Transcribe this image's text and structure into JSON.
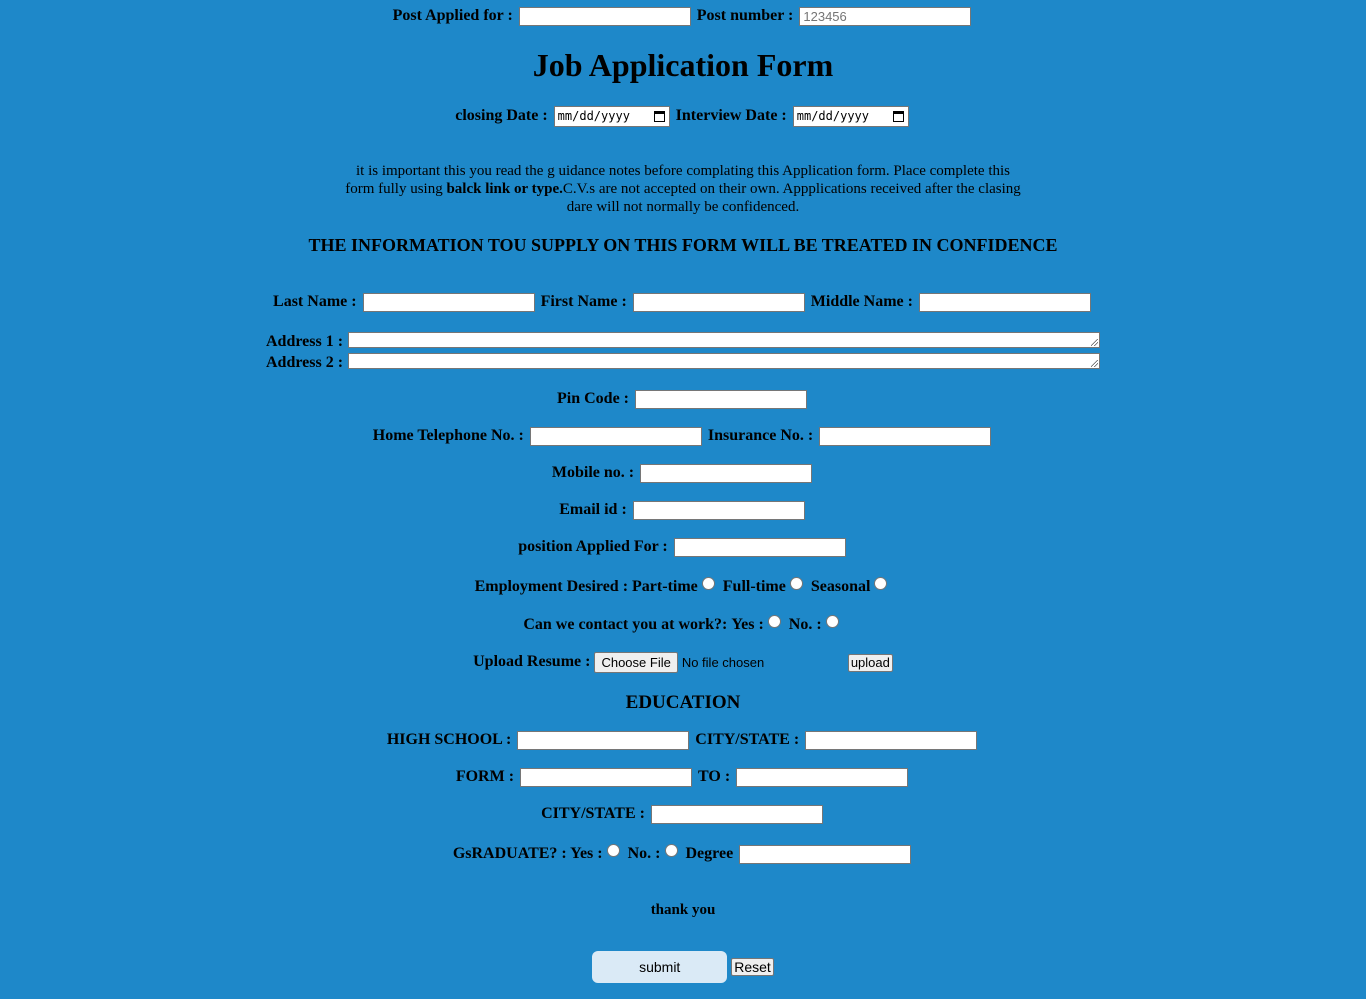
{
  "header": {
    "post_applied_label": "Post Applied for :",
    "post_number_label": "Post number :",
    "post_number_placeholder": "123456"
  },
  "title": "Job Application Form",
  "dates": {
    "closing_label": "closing Date :",
    "interview_label": "Interview Date :",
    "date_placeholder": "mm/dd/yyyy"
  },
  "notes": {
    "line1": "it is important this you read the g uidance notes before complating this Application form. Place complete this",
    "line2_pre": "form fully using ",
    "line2_bold": "balck link or type.",
    "line2_post": "C.V.s are not accepted on their own. Appplications received after the clasing",
    "line3": "dare will not normally be confidenced."
  },
  "confidence_heading": "THE INFORMATION TOU SUPPLY ON THIS FORM WILL BE TREATED IN CONFIDENCE",
  "personal": {
    "last_name_label": "Last Name :",
    "first_name_label": "First Name :",
    "middle_name_label": "Middle Name :",
    "address1_label": "Address 1 :",
    "address2_label": "Address 2 :",
    "pin_code_label": "Pin Code :",
    "home_tel_label": "Home Telephone No. :",
    "insurance_label": "Insurance No. :",
    "mobile_label": "Mobile no. :",
    "email_label": "Email id :",
    "position_label": "position Applied For :"
  },
  "employment": {
    "label": "Employment Desired :",
    "options": [
      "Part-time",
      "Full-time",
      "Seasonal"
    ]
  },
  "contact_work": {
    "label": "Can we contact you at work?:",
    "yes": "Yes :",
    "no": "No. :"
  },
  "resume": {
    "label": "Upload Resume :",
    "choose_file": "Choose File",
    "no_file": "No file chosen",
    "upload": "upload"
  },
  "education": {
    "heading": "EDUCATION",
    "high_school_label": "HIGH SCHOOL :",
    "city_state_label": "CITY/STATE :",
    "form_label": "FORM :",
    "to_label": "TO :",
    "city_state2_label": "CITY/STATE :",
    "graduate_label": "GsRADUATE? : Yes :",
    "no_label": "No. :",
    "degree_label": "Degree"
  },
  "footer": {
    "thank_you": "thank you",
    "submit": "submit",
    "reset": "Reset"
  }
}
